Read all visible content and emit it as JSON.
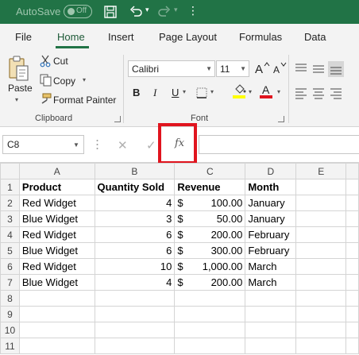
{
  "titlebar": {
    "autosave_label": "AutoSave",
    "toggle_state": "Off"
  },
  "tabs": [
    {
      "label": "File"
    },
    {
      "label": "Home",
      "active": true
    },
    {
      "label": "Insert"
    },
    {
      "label": "Page Layout"
    },
    {
      "label": "Formulas"
    },
    {
      "label": "Data"
    }
  ],
  "clipboard": {
    "paste_label": "Paste",
    "cut_label": "Cut",
    "copy_label": "Copy",
    "format_painter_label": "Format Painter",
    "group_label": "Clipboard"
  },
  "font": {
    "font_name": "Calibri",
    "font_size": "11",
    "bold_label": "B",
    "italic_label": "I",
    "underline_label": "U",
    "font_color_label": "A",
    "group_label": "Font",
    "fill_color": "#ffff00",
    "text_color": "#e0141e"
  },
  "formula_bar": {
    "name_box": "C8",
    "fx_label": "fx",
    "formula_value": ""
  },
  "grid": {
    "columns": [
      "A",
      "B",
      "C",
      "D",
      "E"
    ],
    "row_numbers": [
      "1",
      "2",
      "3",
      "4",
      "5",
      "6",
      "7",
      "8",
      "9",
      "10",
      "11"
    ],
    "header": {
      "product": "Product",
      "quantity": "Quantity Sold",
      "revenue": "Revenue",
      "month": "Month"
    },
    "rows": [
      {
        "product": "Red Widget",
        "quantity": "4",
        "currency": "$",
        "revenue": "100.00",
        "month": "January"
      },
      {
        "product": "Blue Widget",
        "quantity": "3",
        "currency": "$",
        "revenue": "50.00",
        "month": "January"
      },
      {
        "product": "Red Widget",
        "quantity": "6",
        "currency": "$",
        "revenue": "200.00",
        "month": "February"
      },
      {
        "product": "Blue Widget",
        "quantity": "6",
        "currency": "$",
        "revenue": "300.00",
        "month": "February"
      },
      {
        "product": "Red Widget",
        "quantity": "10",
        "currency": "$",
        "revenue": "1,000.00",
        "month": "March"
      },
      {
        "product": "Blue Widget",
        "quantity": "4",
        "currency": "$",
        "revenue": "200.00",
        "month": "March"
      }
    ]
  },
  "colors": {
    "brand": "#217346",
    "highlight": "#e0141e"
  }
}
